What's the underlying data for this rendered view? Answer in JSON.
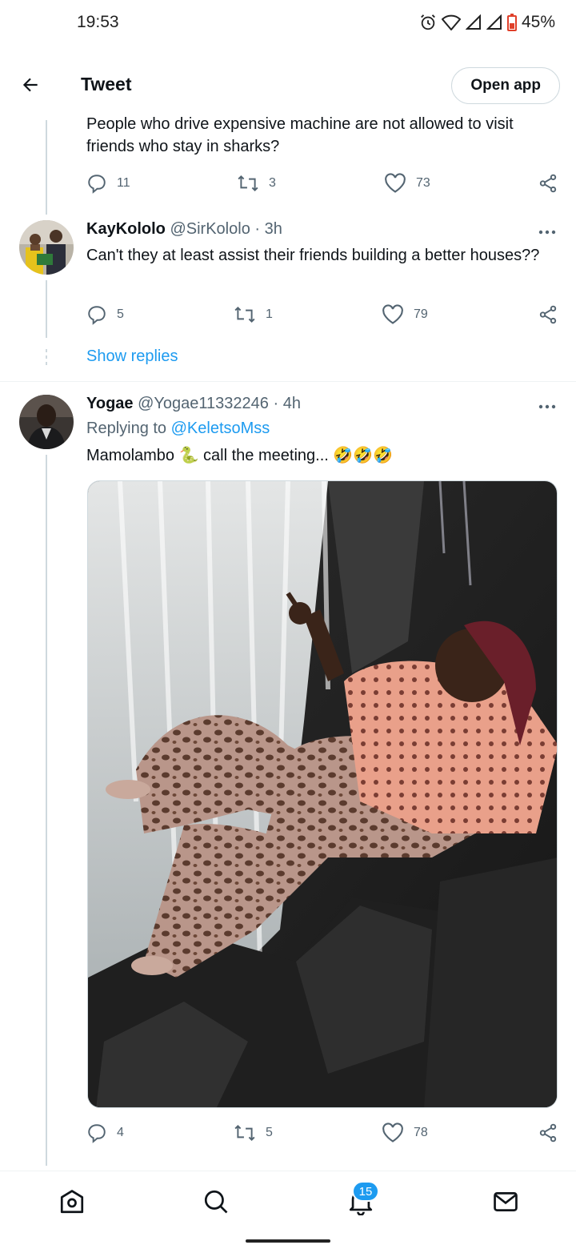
{
  "status_bar": {
    "time": "19:53",
    "battery": "45%",
    "icons": [
      "alarm-icon",
      "wifi-icon",
      "signal-icon",
      "signal-icon",
      "battery-icon"
    ]
  },
  "header": {
    "title": "Tweet",
    "open_app_label": "Open app"
  },
  "tweets": [
    {
      "text": "People who drive expensive machine are not allowed to visit friends who stay in sharks?",
      "replies": "11",
      "retweets": "3",
      "likes": "73"
    },
    {
      "name": "KayKololo",
      "handle": "@SirKololo",
      "time": "3h",
      "text": "Can't they at least assist their friends building a better houses??",
      "replies": "5",
      "retweets": "1",
      "likes": "79",
      "show_replies_label": "Show replies"
    },
    {
      "name": "Yogae",
      "handle": "@Yogae11332246",
      "time": "4h",
      "replying_to_label": "Replying to",
      "replying_to_handle": "@KeletsoMss",
      "text": "Mamolambo 🐍 call the meeting... 🤣🤣🤣",
      "replies": "4",
      "retweets": "5",
      "likes": "78"
    }
  ],
  "bottom_nav": {
    "items": [
      "home-icon",
      "search-icon",
      "notifications-icon",
      "messages-icon"
    ],
    "notifications_badge": "15"
  },
  "colors": {
    "accent": "#1d9bf0",
    "text_primary": "#0f1419",
    "text_secondary": "#536471",
    "border": "#cfd9de"
  }
}
